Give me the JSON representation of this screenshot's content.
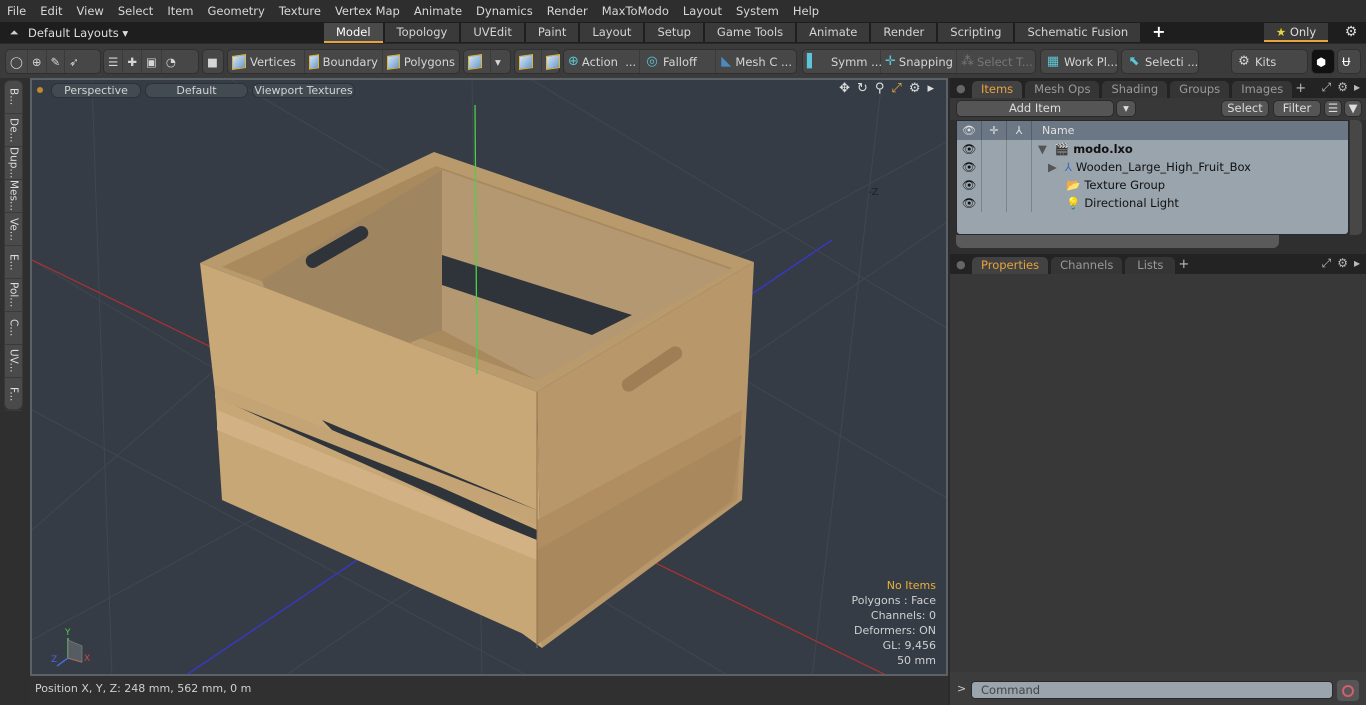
{
  "menu": [
    "File",
    "Edit",
    "View",
    "Select",
    "Item",
    "Geometry",
    "Texture",
    "Vertex Map",
    "Animate",
    "Dynamics",
    "Render",
    "MaxToModo",
    "Layout",
    "System",
    "Help"
  ],
  "layout_bar": {
    "layouts_label": "Default Layouts ▾",
    "tabs": [
      "Model",
      "Topology",
      "UVEdit",
      "Paint",
      "Layout",
      "Setup",
      "Game Tools",
      "Animate",
      "Render",
      "Scripting",
      "Schematic Fusion"
    ],
    "active_tab": "Model",
    "only_label": "Only"
  },
  "toolbar": {
    "vertices": "Vertices",
    "boundary": "Boundary",
    "polygons": "Polygons",
    "action": "Action",
    "action_more": "...",
    "falloff": "Falloff",
    "mesh": "Mesh C ...",
    "symm": "Symm ...",
    "snapping": "Snapping",
    "select_t": "Select T...",
    "work_plane": "Work Pl...",
    "selection": "Selecti ...",
    "kits": "Kits"
  },
  "left_tabs": [
    "B...",
    "De...",
    "Dup...",
    "Mes...",
    "Ve...",
    "E...",
    "Pol...",
    "C...",
    "UV...",
    "F..."
  ],
  "viewport": {
    "view_mode": "Perspective",
    "shading": "Default",
    "textures": "Viewport Textures",
    "axis_label": "-Z",
    "stats": {
      "items": "No Items",
      "polygons": "Polygons : Face",
      "channels": "Channels: 0",
      "deformers": "Deformers: ON",
      "gl": "GL: 9,456",
      "scale": "50 mm"
    },
    "gizmo": {
      "x": "X",
      "y": "Y",
      "z": "Z"
    }
  },
  "status": {
    "position": "Position X, Y, Z:   248 mm, 562 mm, 0 m"
  },
  "items_panel": {
    "tabs": [
      "Items",
      "Mesh Ops",
      "Shading",
      "Groups",
      "Images"
    ],
    "active_tab": "Items",
    "add_item": "Add Item",
    "select": "Select",
    "filter": "Filter",
    "column_name": "Name",
    "tree": [
      {
        "label": "modo.lxo",
        "bold": true
      },
      {
        "label": "Wooden_Large_High_Fruit_Box"
      },
      {
        "label": "Texture Group"
      },
      {
        "label": "Directional Light"
      }
    ]
  },
  "properties_panel": {
    "tabs": [
      "Properties",
      "Channels",
      "Lists"
    ],
    "active_tab": "Properties"
  },
  "command": {
    "placeholder": "Command",
    "prompt": ">"
  },
  "colors": {
    "accent": "#e8a33d",
    "viewport_bg": "#353c45",
    "wood": "#c9a878"
  }
}
